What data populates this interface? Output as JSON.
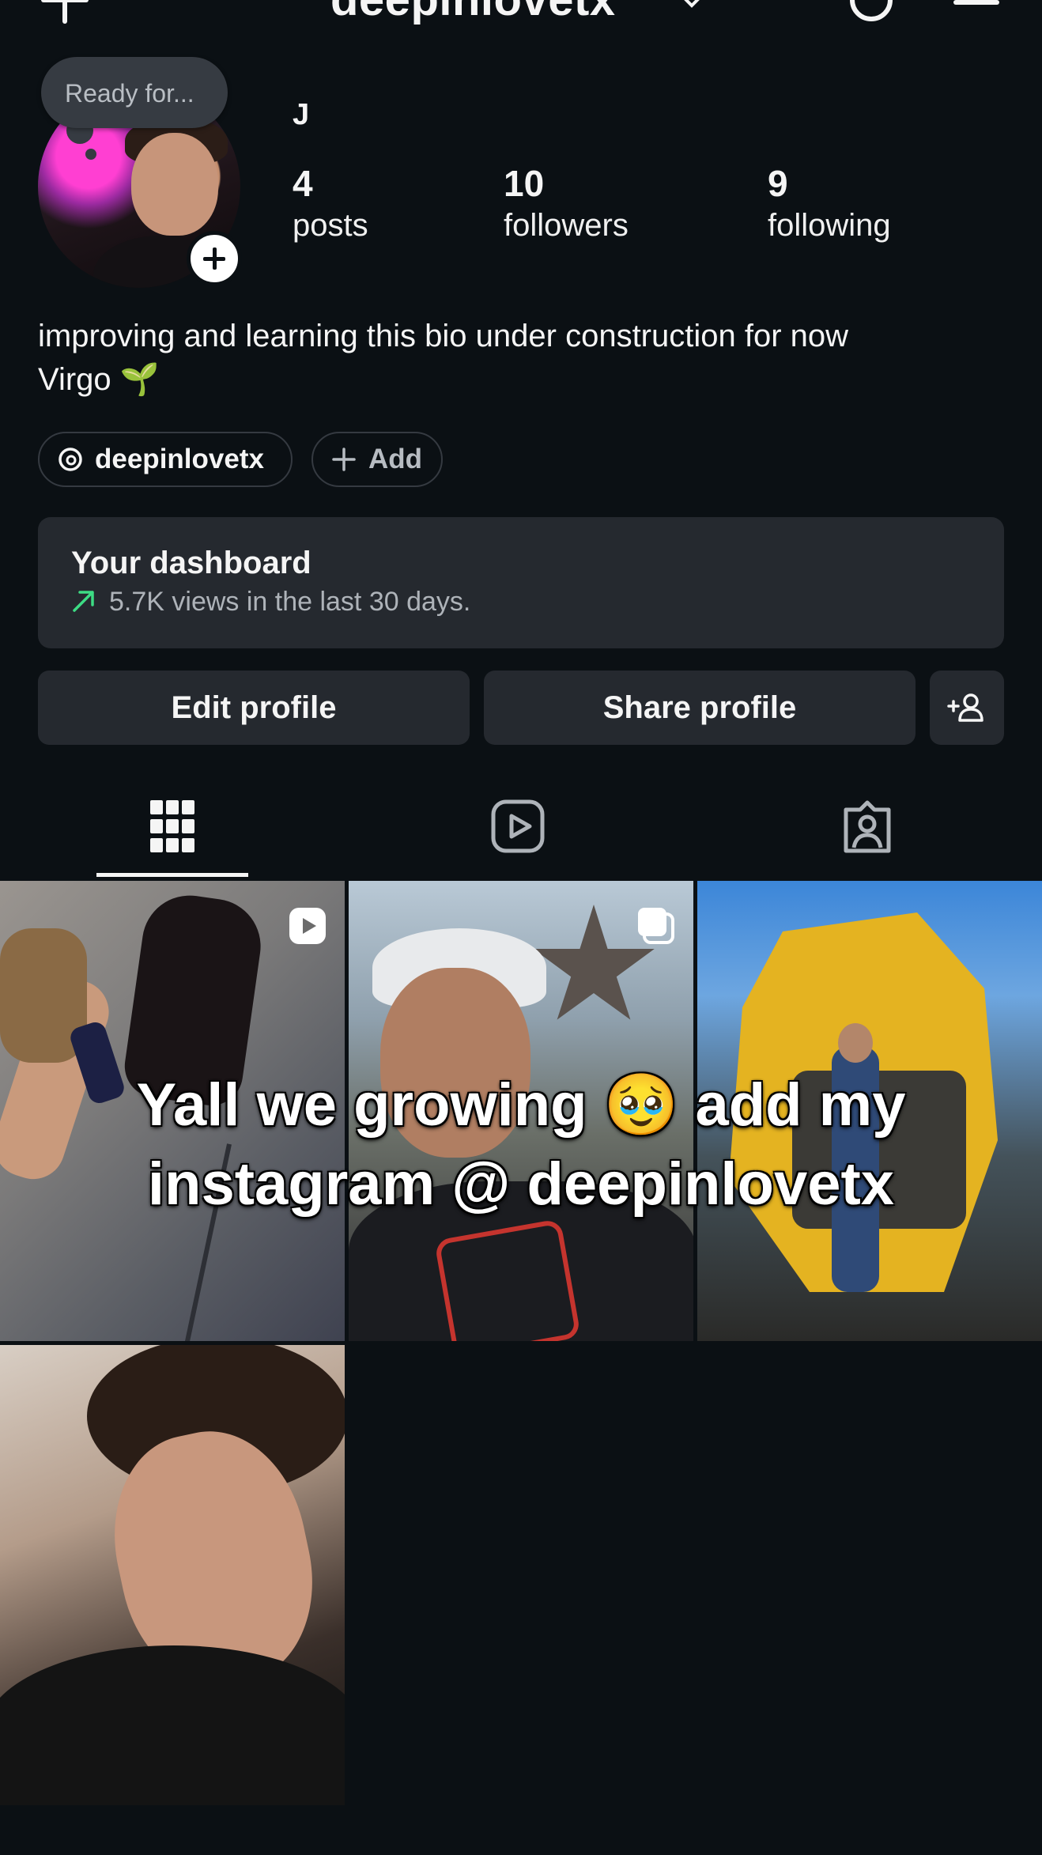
{
  "header": {
    "username": "deepinlovetx",
    "icons": [
      "plus-icon",
      "chevron-down-icon",
      "threads-icon",
      "menu-icon"
    ]
  },
  "profile": {
    "note": "Ready for...",
    "display_name": "J",
    "stats": [
      {
        "value": "4",
        "label": "posts"
      },
      {
        "value": "10",
        "label": "followers"
      },
      {
        "value": "9",
        "label": "following"
      }
    ],
    "bio_line1": "improving and learning this bio under construction for now",
    "bio_line2": "Virgo 🌱",
    "threads_handle": "deepinlovetx",
    "add_label": "Add"
  },
  "dashboard": {
    "title": "Your dashboard",
    "subtitle": "5.7K views in the last 30 days."
  },
  "actions": {
    "edit_profile": "Edit profile",
    "share_profile": "Share profile"
  },
  "tabs": [
    "grid-icon",
    "reels-icon",
    "tagged-icon"
  ],
  "overlay_caption_line1": "Yall we growing 🥹 add my",
  "overlay_caption_line2": "instagram @ deepinlovetx",
  "colors": {
    "background": "#0b1014",
    "card": "#25292f",
    "accent_green": "#3ddc84"
  }
}
